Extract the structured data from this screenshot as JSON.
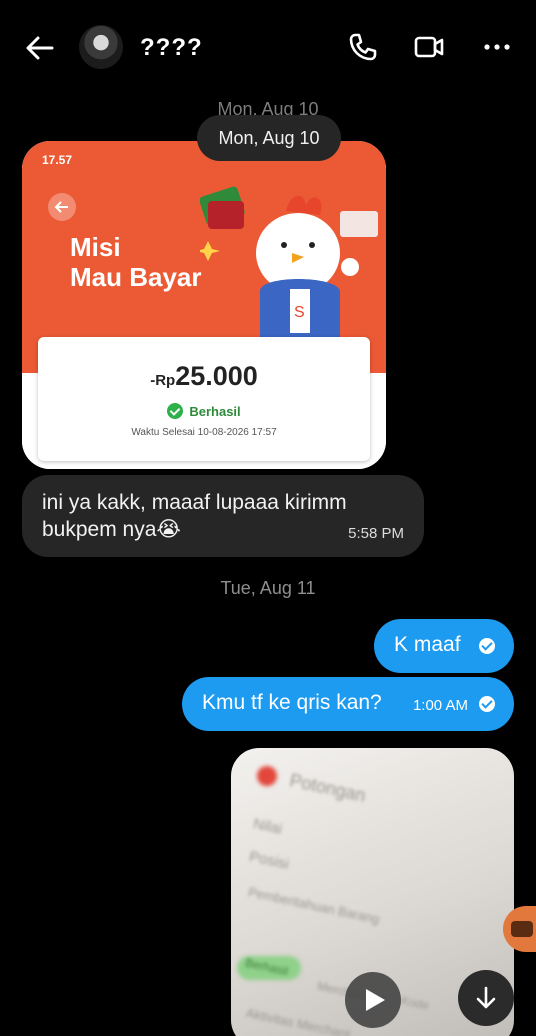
{
  "header": {
    "contact_name": "????",
    "icons": [
      "arrow-left-icon",
      "phone-icon",
      "video-camera-icon",
      "more-horizontal-icon"
    ]
  },
  "dates": {
    "ghost": "Mon, Aug 10",
    "chip": "Mon, Aug 10",
    "second": "Tue, Aug 11"
  },
  "image_message": {
    "status_time": "17.57",
    "promo_line1": "Misi",
    "promo_line2": "Mau Bayar",
    "amount_currency": "-Rp",
    "amount_value": "25.000",
    "status": "Berhasil",
    "completed_at": "Waktu Selesai 10-08-2026 17:57",
    "banner_color": "#ec5a35"
  },
  "received_message": {
    "text": "ini ya kakk, maaaf lupaaa kirimm bukpem nya😭",
    "time": "5:58 PM"
  },
  "sent_messages": [
    {
      "text": "K maaf",
      "time": ""
    },
    {
      "text": "Kmu tf ke qris kan?",
      "time": "1:00 AM"
    }
  ],
  "video_message": {
    "blurred_text": [
      "Potongan",
      "Nilai",
      "Posisi",
      "Pemberitahuan Barang",
      "Berhasil",
      "Merchant",
      "Kode",
      "Aktivitas Merchant"
    ]
  },
  "colors": {
    "sent_bubble": "#1d9bf0",
    "received_bubble": "#262626",
    "background": "#000000"
  }
}
